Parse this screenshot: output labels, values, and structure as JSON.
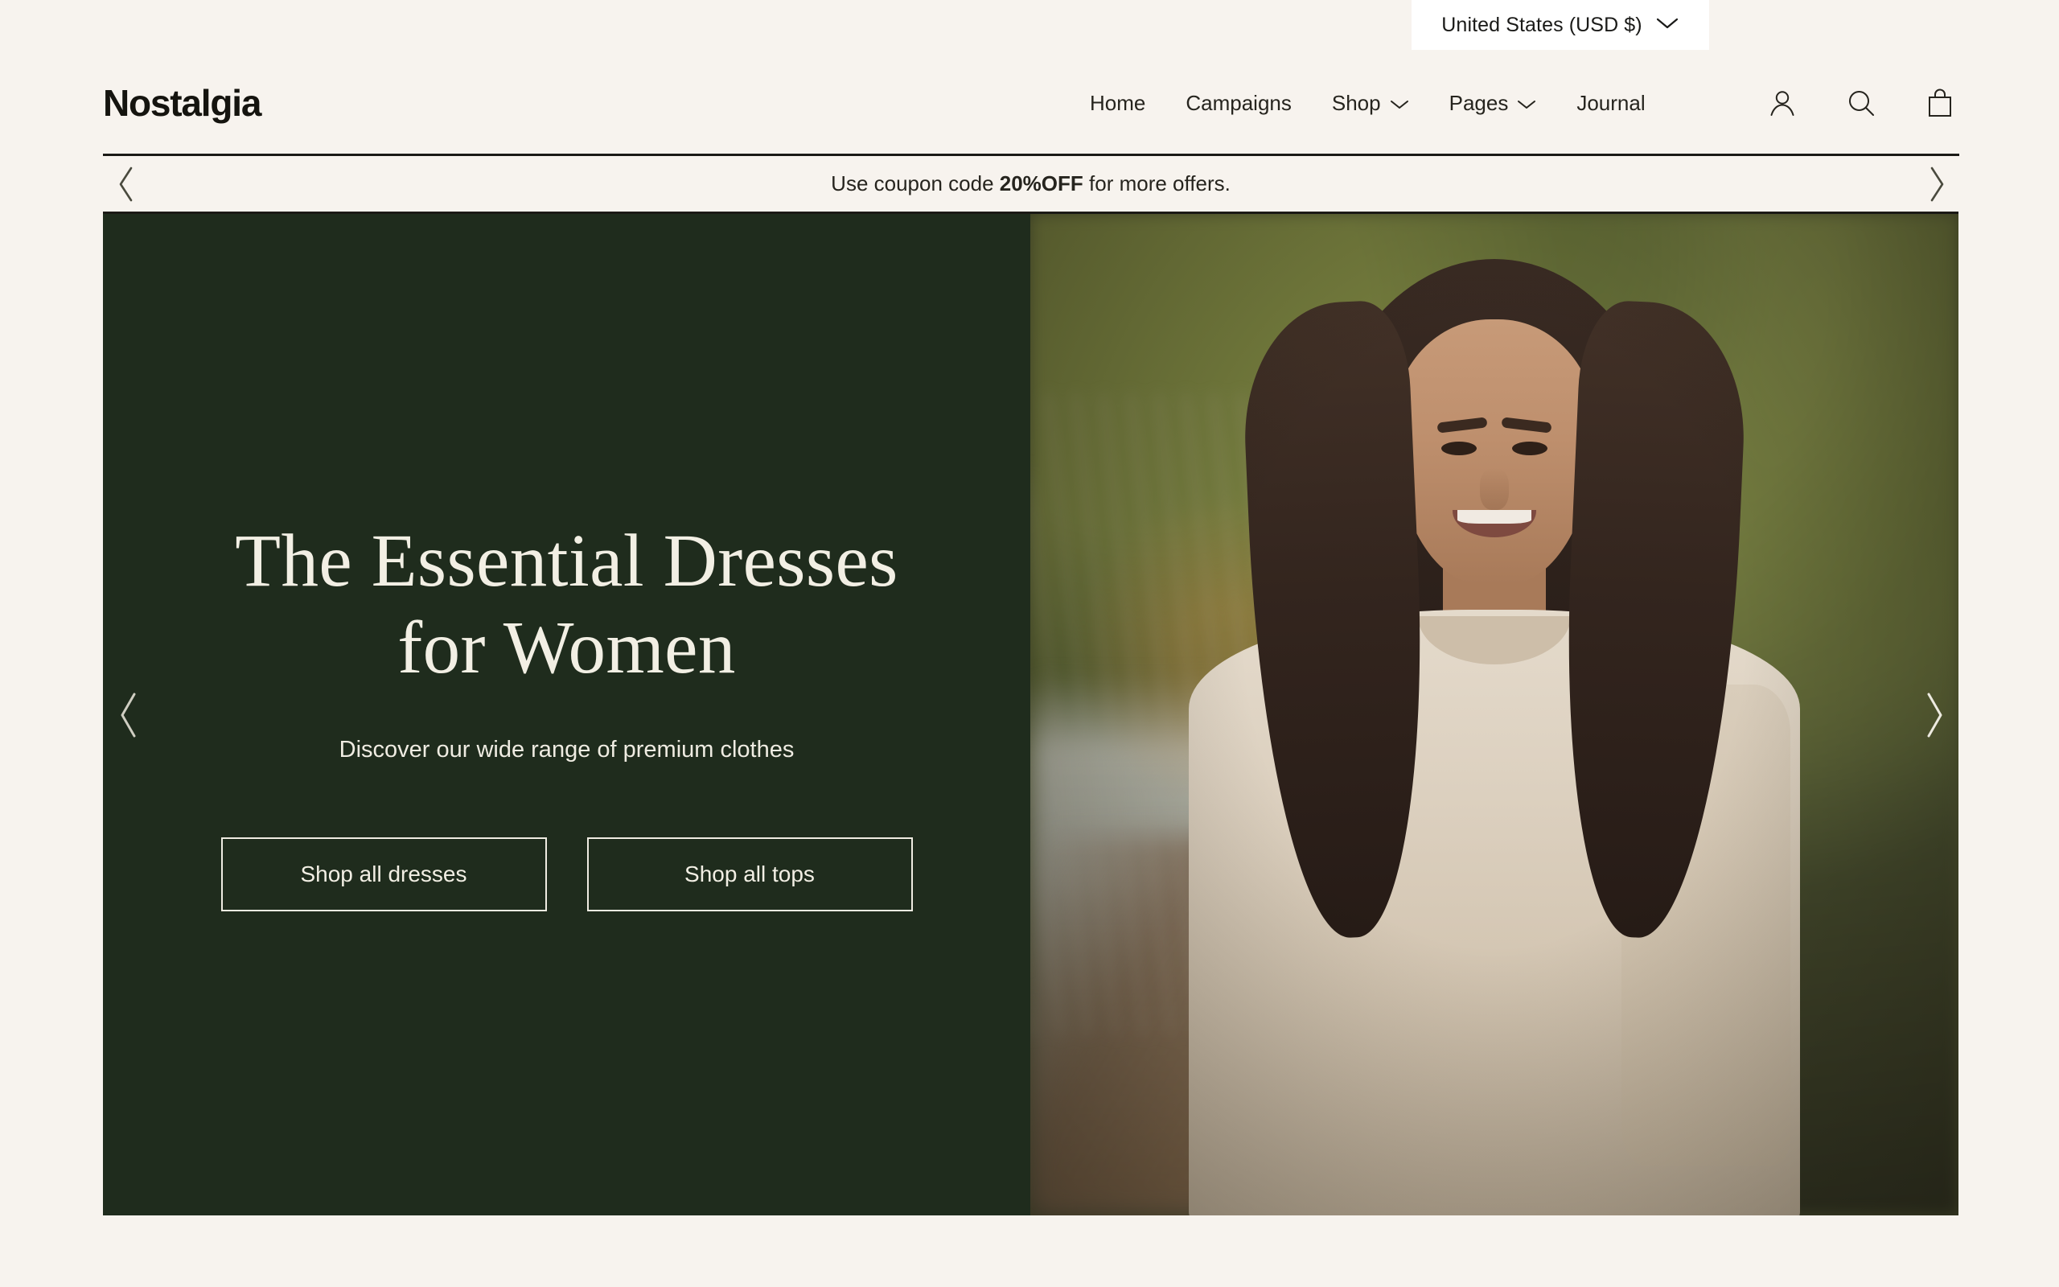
{
  "topbar": {
    "locale_label": "United States (USD $)",
    "locale_icon": "chevron-down-icon"
  },
  "header": {
    "logo": "Nostalgia",
    "nav": [
      {
        "label": "Home",
        "has_dropdown": false
      },
      {
        "label": "Campaigns",
        "has_dropdown": false
      },
      {
        "label": "Shop",
        "has_dropdown": true
      },
      {
        "label": "Pages",
        "has_dropdown": true
      },
      {
        "label": "Journal",
        "has_dropdown": false
      }
    ],
    "icons": [
      "account-icon",
      "search-icon",
      "shopping-bag-icon"
    ]
  },
  "announcement": {
    "text_before": "Use coupon code ",
    "code": "20%OFF",
    "text_after": " for more offers.",
    "prev_icon": "chevron-left-icon",
    "next_icon": "chevron-right-icon"
  },
  "hero": {
    "title_line1": "The Essential Dresses",
    "title_line2": "for Women",
    "subtitle": "Discover our wide range of premium clothes",
    "cta_primary": "Shop all dresses",
    "cta_secondary": "Shop all tops",
    "prev_icon": "chevron-left-icon",
    "next_icon": "chevron-right-icon",
    "image_alt": "Smiling woman with long dark hair wearing a beige sweatshirt on a lakeside dock"
  },
  "colors": {
    "page_bg": "#F7F3EE",
    "hero_green": "#1F2C1D",
    "cream_text": "#F2EFE4",
    "ink": "#1B1A16"
  }
}
